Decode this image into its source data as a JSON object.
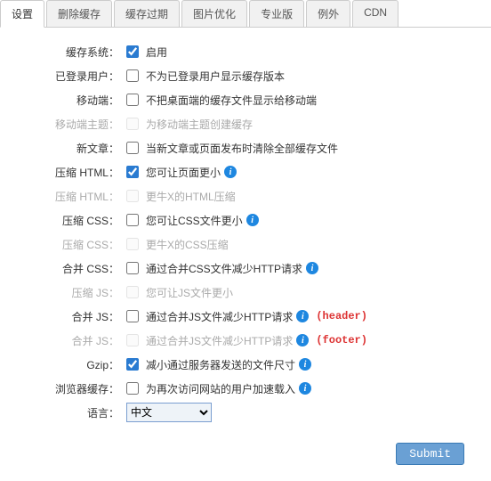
{
  "tabs": [
    "设置",
    "删除缓存",
    "缓存过期",
    "图片优化",
    "专业版",
    "例外",
    "CDN"
  ],
  "active_tab": 0,
  "rows": [
    {
      "label": "缓存系统：",
      "text": "启用",
      "checked": true,
      "disabled": false,
      "info": false,
      "marker": ""
    },
    {
      "label": "已登录用户：",
      "text": "不为已登录用户显示缓存版本",
      "checked": false,
      "disabled": false,
      "info": false,
      "marker": ""
    },
    {
      "label": "移动端：",
      "text": "不把桌面端的缓存文件显示给移动端",
      "checked": false,
      "disabled": false,
      "info": false,
      "marker": ""
    },
    {
      "label": "移动端主题：",
      "text": "为移动端主题创建缓存",
      "checked": false,
      "disabled": true,
      "info": false,
      "marker": ""
    },
    {
      "label": "新文章：",
      "text": "当新文章或页面发布时清除全部缓存文件",
      "checked": false,
      "disabled": false,
      "info": false,
      "marker": ""
    },
    {
      "label": "压缩 HTML：",
      "text": "您可让页面更小",
      "checked": true,
      "disabled": false,
      "info": true,
      "marker": ""
    },
    {
      "label": "压缩 HTML：",
      "text": "更牛X的HTML压缩",
      "checked": false,
      "disabled": true,
      "info": false,
      "marker": ""
    },
    {
      "label": "压缩 CSS：",
      "text": "您可让CSS文件更小",
      "checked": false,
      "disabled": false,
      "info": true,
      "marker": ""
    },
    {
      "label": "压缩 CSS：",
      "text": "更牛X的CSS压缩",
      "checked": false,
      "disabled": true,
      "info": false,
      "marker": ""
    },
    {
      "label": "合并 CSS：",
      "text": "通过合并CSS文件减少HTTP请求",
      "checked": false,
      "disabled": false,
      "info": true,
      "marker": ""
    },
    {
      "label": "压缩 JS：",
      "text": "您可让JS文件更小",
      "checked": false,
      "disabled": true,
      "info": false,
      "marker": ""
    },
    {
      "label": "合并 JS：",
      "text": "通过合并JS文件减少HTTP请求",
      "checked": false,
      "disabled": false,
      "info": true,
      "marker": "(header)"
    },
    {
      "label": "合并 JS：",
      "text": "通过合并JS文件减少HTTP请求",
      "checked": false,
      "disabled": true,
      "info": true,
      "marker": "(footer)"
    },
    {
      "label": "Gzip：",
      "text": "减小通过服务器发送的文件尺寸",
      "checked": true,
      "disabled": false,
      "info": true,
      "marker": ""
    },
    {
      "label": "浏览器缓存：",
      "text": "为再次访问网站的用户加速载入",
      "checked": false,
      "disabled": false,
      "info": true,
      "marker": ""
    }
  ],
  "language_label": "语言：",
  "language_value": "中文",
  "submit_label": "Submit",
  "info_glyph": "i"
}
